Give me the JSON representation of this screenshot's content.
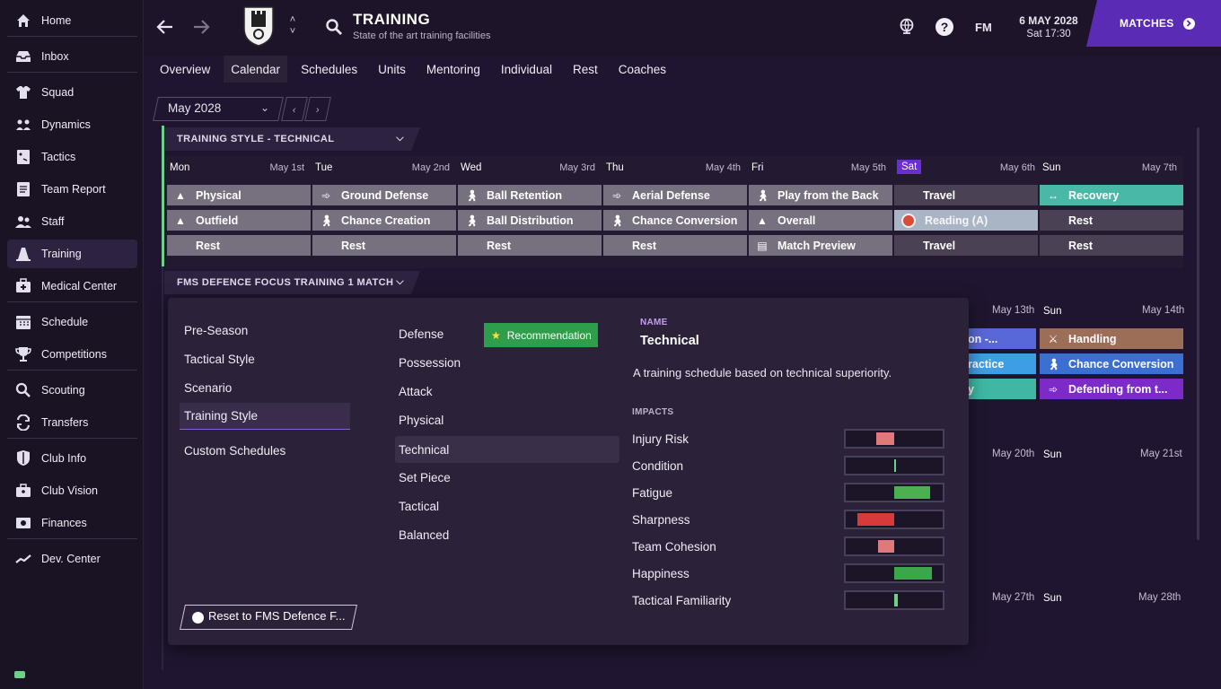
{
  "sidebar": {
    "items": [
      {
        "label": "Home",
        "icon": "home-icon"
      },
      {
        "label": "Inbox",
        "icon": "inbox-icon"
      },
      {
        "label": "Squad",
        "icon": "shirt-icon"
      },
      {
        "label": "Dynamics",
        "icon": "dynamics-icon"
      },
      {
        "label": "Tactics",
        "icon": "tactics-icon"
      },
      {
        "label": "Team Report",
        "icon": "report-icon"
      },
      {
        "label": "Staff",
        "icon": "staff-icon"
      },
      {
        "label": "Training",
        "icon": "cone-icon"
      },
      {
        "label": "Medical Center",
        "icon": "medical-icon"
      },
      {
        "label": "Schedule",
        "icon": "calendar-icon"
      },
      {
        "label": "Competitions",
        "icon": "trophy-icon"
      },
      {
        "label": "Scouting",
        "icon": "search-icon"
      },
      {
        "label": "Transfers",
        "icon": "transfer-icon"
      },
      {
        "label": "Club Info",
        "icon": "shield-icon"
      },
      {
        "label": "Club Vision",
        "icon": "briefcase-icon"
      },
      {
        "label": "Finances",
        "icon": "money-icon"
      },
      {
        "label": "Dev. Center",
        "icon": "chart-icon"
      }
    ]
  },
  "header": {
    "title": "TRAINING",
    "subtitle": "State of the art training facilities",
    "fm_label": "FM",
    "date": "6 MAY 2028",
    "time": "Sat 17:30",
    "matches_label": "MATCHES"
  },
  "tabs": [
    "Overview",
    "Calendar",
    "Schedules",
    "Units",
    "Mentoring",
    "Individual",
    "Rest",
    "Coaches"
  ],
  "month_selector": {
    "value": "May 2028"
  },
  "section1": {
    "title": "TRAINING STYLE - TECHNICAL"
  },
  "section2": {
    "title": "FMS DEFENCE FOCUS TRAINING 1 MATCH"
  },
  "days": [
    {
      "name": "Mon",
      "date": "May 1st"
    },
    {
      "name": "Tue",
      "date": "May 2nd"
    },
    {
      "name": "Wed",
      "date": "May 3rd"
    },
    {
      "name": "Thu",
      "date": "May 4th"
    },
    {
      "name": "Fri",
      "date": "May 5th"
    },
    {
      "name": "Sat",
      "date": "May 6th"
    },
    {
      "name": "Sun",
      "date": "May 7th"
    }
  ],
  "sessions": {
    "row1": [
      "Physical",
      "Ground Defense",
      "Ball Retention",
      "Aerial Defense",
      "Play from the Back",
      "Travel",
      "Recovery"
    ],
    "row2": [
      "Outfield",
      "Chance Creation",
      "Ball Distribution",
      "Chance Conversion",
      "Overall",
      "Reading (A)",
      "Rest"
    ],
    "row3": [
      "Rest",
      "Rest",
      "Rest",
      "Rest",
      "Match Preview",
      "Travel",
      "Rest"
    ]
  },
  "week2": {
    "sat_date": "May 13th",
    "sun_name": "Sun",
    "sun_date": "May 14th",
    "sat_cells": [
      "on -...",
      "ractice",
      "y"
    ],
    "sun_cells": [
      "Handling",
      "Chance Conversion",
      "Defending from t..."
    ]
  },
  "week3": {
    "sat_date": "May 20th",
    "sun_name": "Sun",
    "sun_date": "May 21st"
  },
  "week4": {
    "sat_date": "May 27th",
    "sun_name": "Sun",
    "sun_date": "May 28th"
  },
  "popup": {
    "categories": [
      "Pre-Season",
      "Tactical Style",
      "Scenario",
      "Training Style",
      "Custom Schedules"
    ],
    "schedules": [
      "Defense",
      "Possession",
      "Attack",
      "Physical",
      "Technical",
      "Set Piece",
      "Tactical",
      "Balanced"
    ],
    "recommendation": "Recommendation",
    "name_label": "NAME",
    "name_value": "Technical",
    "description": "A training schedule based on technical superiority.",
    "impacts_label": "IMPACTS",
    "impacts": [
      {
        "name": "Injury Risk",
        "level": "slightly-negative",
        "color": "#e07a7a"
      },
      {
        "name": "Condition",
        "level": "neutral",
        "color": "#6fd08a"
      },
      {
        "name": "Fatigue",
        "level": "positive",
        "color": "#4caf50"
      },
      {
        "name": "Sharpness",
        "level": "negative",
        "color": "#d63a3a"
      },
      {
        "name": "Team Cohesion",
        "level": "slightly-negative",
        "color": "#e07a7a"
      },
      {
        "name": "Happiness",
        "level": "positive",
        "color": "#3ea64a"
      },
      {
        "name": "Tactical Familiarity",
        "level": "neutral",
        "color": "#6fd08a"
      }
    ],
    "reset_label": "Reset to FMS Defence F..."
  }
}
